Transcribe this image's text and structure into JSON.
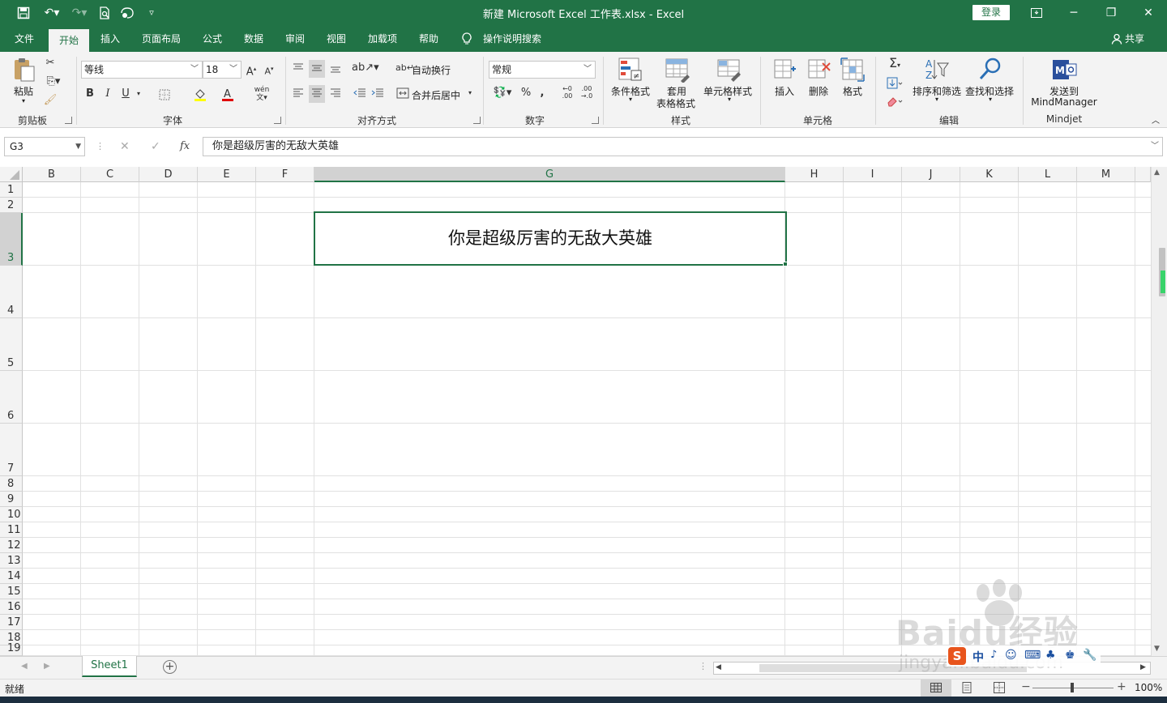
{
  "window": {
    "title": "新建 Microsoft Excel 工作表.xlsx  -  Excel",
    "login": "登录",
    "share": "共享"
  },
  "tabs": [
    "文件",
    "开始",
    "插入",
    "页面布局",
    "公式",
    "数据",
    "审阅",
    "视图",
    "加载项",
    "帮助"
  ],
  "tell_me": "操作说明搜索",
  "ribbon": {
    "clipboard": {
      "paste": "粘贴",
      "label": "剪贴板"
    },
    "font": {
      "name": "等线",
      "size": "18",
      "bold": "B",
      "italic": "I",
      "underline": "U",
      "label": "字体"
    },
    "alignment": {
      "wrap": "自动换行",
      "merge": "合并后居中",
      "label": "对齐方式"
    },
    "number": {
      "format": "常规",
      "percent": "%",
      "comma": ",",
      "label": "数字"
    },
    "styles": {
      "conditional": "条件格式",
      "table_line1": "套用",
      "table_line2": "表格格式",
      "cell_styles": "单元格样式",
      "label": "样式"
    },
    "cells": {
      "insert": "插入",
      "delete": "删除",
      "format": "格式",
      "label": "单元格"
    },
    "editing": {
      "sort": "排序和筛选",
      "find": "查找和选择",
      "label": "编辑"
    },
    "mindjet": {
      "send_line1": "发送到",
      "send_line2": "MindManager",
      "label": "Mindjet"
    }
  },
  "formula_bar": {
    "name_box": "G3",
    "fx": "fx",
    "content": "你是超级厉害的无敌大英雄"
  },
  "columns": [
    "B",
    "C",
    "D",
    "E",
    "F",
    "G",
    "H",
    "I",
    "J",
    "K",
    "L",
    "M"
  ],
  "rows": [
    "1",
    "2",
    "3",
    "4",
    "5",
    "6",
    "7",
    "8",
    "9",
    "10",
    "11",
    "12",
    "13",
    "14",
    "15",
    "16",
    "17",
    "18",
    "19"
  ],
  "active_cell": {
    "ref": "G3",
    "text": "你是超级厉害的无敌大英雄"
  },
  "sheets": [
    "Sheet1"
  ],
  "status": {
    "ready": "就绪",
    "zoom": "100%"
  },
  "watermark": {
    "brand": "Baidu经验",
    "url": "jingyan.baidu.com"
  },
  "colors": {
    "accent": "#217346"
  }
}
